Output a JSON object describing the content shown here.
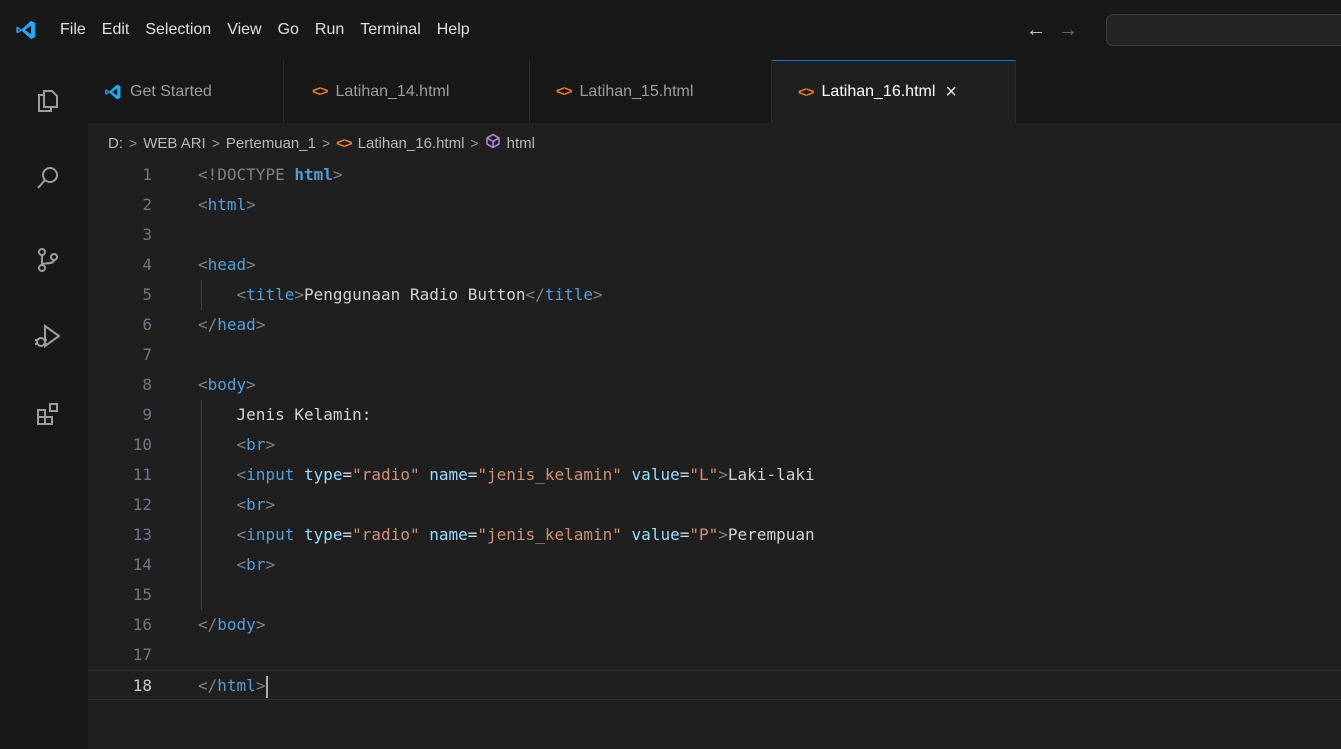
{
  "menu": [
    "File",
    "Edit",
    "Selection",
    "View",
    "Go",
    "Run",
    "Terminal",
    "Help"
  ],
  "nav": {
    "back": "←",
    "forward": "→"
  },
  "tabs": [
    {
      "label": "Get Started",
      "icon": "vscode-logo-icon",
      "active": false
    },
    {
      "label": "Latihan_14.html",
      "icon": "html-file-icon",
      "active": false
    },
    {
      "label": "Latihan_15.html",
      "icon": "html-file-icon",
      "active": false
    },
    {
      "label": "Latihan_16.html",
      "icon": "html-file-icon",
      "active": true,
      "close": "×"
    }
  ],
  "breadcrumb": [
    "D:",
    "WEB ARI",
    "Pertemuan_1",
    "Latihan_16.html",
    "html"
  ],
  "editor": {
    "line_numbers": [
      "1",
      "2",
      "3",
      "4",
      "5",
      "6",
      "7",
      "8",
      "9",
      "10",
      "11",
      "12",
      "13",
      "14",
      "15",
      "16",
      "17",
      "18"
    ],
    "current_line": 18,
    "lines": [
      "<!DOCTYPE html>",
      "<html>",
      "",
      "<head>",
      "    <title>Penggunaan Radio Button</title>",
      "</head>",
      "",
      "<body>",
      "    Jenis Kelamin:",
      "    <br>",
      "    <input type=\"radio\" name=\"jenis_kelamin\" value=\"L\">Laki-laki",
      "    <br>",
      "    <input type=\"radio\" name=\"jenis_kelamin\" value=\"P\">Perempuan",
      "    <br>",
      "",
      "</body>",
      "",
      "</html>"
    ]
  },
  "colors": {
    "accent": "#0078d4",
    "html_icon": "#e37933",
    "logo": "#23a9f2"
  }
}
